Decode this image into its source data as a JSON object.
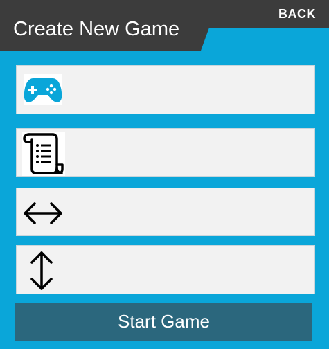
{
  "header": {
    "title": "Create New Game",
    "back_label": "BACK"
  },
  "fields": [
    {
      "icon": "gamepad-icon",
      "value": "",
      "placeholder": ""
    },
    {
      "icon": "scroll-document-icon",
      "value": "",
      "placeholder": ""
    },
    {
      "icon": "horizontal-arrows-icon",
      "value": "",
      "placeholder": ""
    },
    {
      "icon": "vertical-arrows-icon",
      "value": "",
      "placeholder": ""
    }
  ],
  "start_button": {
    "label": "Start Game"
  },
  "colors": {
    "background": "#0aa6d9",
    "header": "#3c3c3c",
    "field": "#f2f2f2",
    "button": "#2b677d",
    "gamepad": "#0aa6d9"
  }
}
